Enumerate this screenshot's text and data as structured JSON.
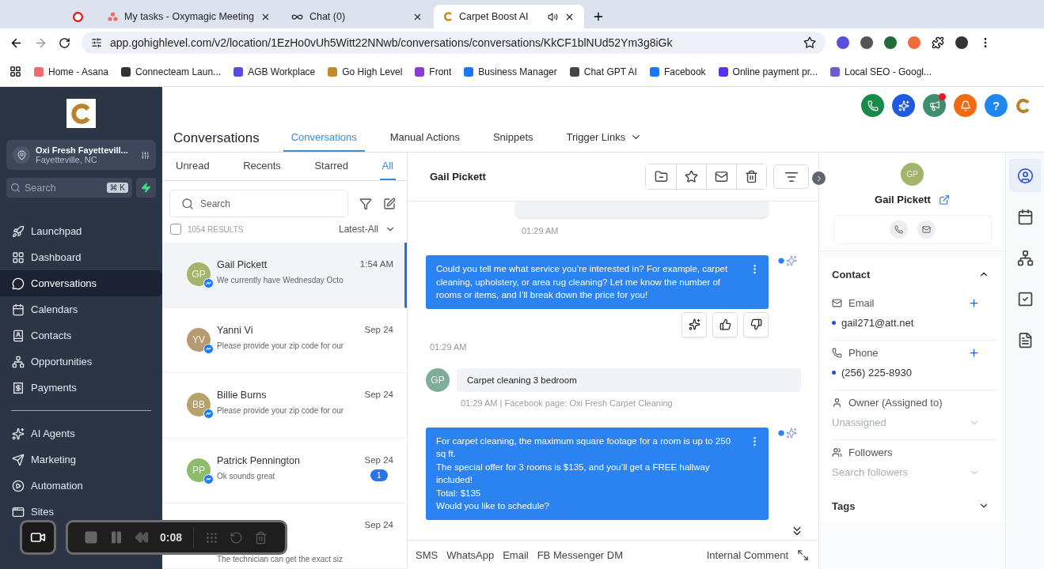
{
  "browser": {
    "tabs": [
      {
        "selected": false
      },
      {
        "title": "My tasks - Oxymagic Meeting",
        "selected": false
      },
      {
        "title": "Chat (0)",
        "selected": false
      },
      {
        "title": "Carpet Boost AI",
        "selected": true,
        "audio": true
      }
    ],
    "url": "app.gohighlevel.com/v2/location/1EzHo0vUh5Witt22NNwb/conversations/conversations/KkCF1blNUd52Ym3g8iGk",
    "bookmarks": [
      {
        "label": "Home - Asana",
        "color": "#f06a6a"
      },
      {
        "label": "Connecteam Laun...",
        "color": "#333333"
      },
      {
        "label": "AGB Workplace",
        "color": "#5b4ce0"
      },
      {
        "label": "Go High Level",
        "color": "#c48a2c"
      },
      {
        "label": "Front",
        "color": "#8a3ad6"
      },
      {
        "label": "Business Manager",
        "color": "#1877f2"
      },
      {
        "label": "Chat GPT AI",
        "color": "#444444"
      },
      {
        "label": "Facebook",
        "color": "#1877f2"
      },
      {
        "label": "Online payment pr...",
        "color": "#5a31f4"
      },
      {
        "label": "Local SEO - Googl...",
        "color": "#6b5bd6"
      }
    ]
  },
  "sidebar": {
    "location": {
      "name": "Oxi Fresh Fayettevill...",
      "city": "Fayetteville, NC"
    },
    "search": {
      "placeholder": "Search",
      "shortcut": "⌘ K"
    },
    "groups": [
      [
        {
          "label": "Launchpad",
          "selected": false
        },
        {
          "label": "Dashboard",
          "selected": false
        },
        {
          "label": "Conversations",
          "selected": true
        },
        {
          "label": "Calendars",
          "selected": false
        },
        {
          "label": "Contacts",
          "selected": false
        },
        {
          "label": "Opportunities",
          "selected": false
        },
        {
          "label": "Payments",
          "selected": false
        }
      ],
      [
        {
          "label": "AI Agents",
          "selected": false
        },
        {
          "label": "Marketing",
          "selected": false
        },
        {
          "label": "Automation",
          "selected": false
        },
        {
          "label": "Sites",
          "selected": false
        }
      ]
    ]
  },
  "header": {
    "title": "Conversations",
    "tabs": [
      {
        "label": "Conversations",
        "selected": true,
        "dropdown": false
      },
      {
        "label": "Manual Actions",
        "selected": false,
        "dropdown": false
      },
      {
        "label": "Snippets",
        "selected": false,
        "dropdown": false
      },
      {
        "label": "Trigger Links",
        "selected": false,
        "dropdown": true
      }
    ],
    "actions": [
      {
        "color": "#188a4a",
        "dot": false
      },
      {
        "color": "#1f5be0",
        "dot": false
      },
      {
        "color": "#3f8f6f",
        "dot": true
      },
      {
        "color": "#f36a12",
        "dot": false
      },
      {
        "color": "#1e88f0",
        "dot": false
      }
    ],
    "help_label": "?"
  },
  "inbox": {
    "filters": [
      {
        "label": "Unread",
        "selected": false
      },
      {
        "label": "Recents",
        "selected": false
      },
      {
        "label": "Starred",
        "selected": false
      },
      {
        "label": "All",
        "selected": true
      }
    ],
    "search": {
      "placeholder": "Search"
    },
    "select_all": {
      "checked": false
    },
    "results": "1054 RESULTS",
    "sort": "Latest-All",
    "conversations": [
      {
        "initials": "GP",
        "color": "#a3b56b",
        "name": "Gail Pickett",
        "preview": "We currently have Wednesday Octo",
        "time": "1:54 AM",
        "selected": true
      },
      {
        "initials": "YV",
        "color": "#b59a72",
        "name": "Yanni Vi",
        "preview": "Please provide your zip code for our",
        "time": "Sep 24",
        "selected": false
      },
      {
        "initials": "BB",
        "color": "#b8a26c",
        "name": "Billie Burns",
        "preview": "Please provide your zip code for our",
        "time": "Sep 24",
        "selected": false
      },
      {
        "initials": "PP",
        "color": "#8bbd6b",
        "name": "Patrick Pennington",
        "preview": "Ok sounds great",
        "time": "Sep 24",
        "selected": false,
        "unread": "1"
      },
      {
        "preview": "The technician can get the exact siz",
        "time": "Sep 24",
        "selected": false
      }
    ]
  },
  "chat": {
    "contact": "Gail Pickett",
    "messages": [
      {
        "kind": "stub",
        "time": "01:29 AM"
      },
      {
        "kind": "outgoing",
        "text": "Could you tell me what service you’re interested in? For example, carpet cleaning, upholstery, or area rug cleaning? Let me know the number of rooms or items, and I’ll break down the price for you!",
        "feedback": true
      },
      {
        "kind": "time",
        "text": "01:29 AM"
      },
      {
        "kind": "incoming",
        "initials": "GP",
        "text": "Carpet cleaning 3 bedroom",
        "meta": "01:29 AM | Facebook page: Oxi Fresh Carpet Cleaning"
      },
      {
        "kind": "outgoing",
        "text": "For carpet cleaning, the maximum square footage for a room is up to 250 sq ft.\nThe special offer for 3 rooms is $135, and you’ll get a FREE hallway included!\nTotal: $135\nWould you like to schedule?",
        "feedback": false
      }
    ],
    "channels": [
      "SMS",
      "WhatsApp",
      "Email",
      "FB Messenger DM"
    ],
    "internal": "Internal Comment"
  },
  "contact": {
    "initials": "GP",
    "name": "Gail Pickett",
    "sections": [
      {
        "title": "Contact",
        "expanded": true
      },
      {
        "title": "Tags",
        "expanded": false
      }
    ],
    "fields": [
      {
        "kind": "list",
        "label": "Email",
        "value": "gail271@att.net"
      },
      {
        "kind": "list",
        "label": "Phone",
        "value": "(256) 225-8930"
      },
      {
        "kind": "select",
        "label": "Owner (Assigned to)",
        "placeholder": "Unassigned"
      },
      {
        "kind": "select",
        "label": "Followers",
        "placeholder": "Search followers"
      }
    ],
    "rail": [
      {
        "selected": true
      },
      {
        "selected": false
      },
      {
        "selected": false
      },
      {
        "selected": false
      },
      {
        "selected": false
      }
    ]
  },
  "recorder": {
    "elapsed": "0:08"
  }
}
